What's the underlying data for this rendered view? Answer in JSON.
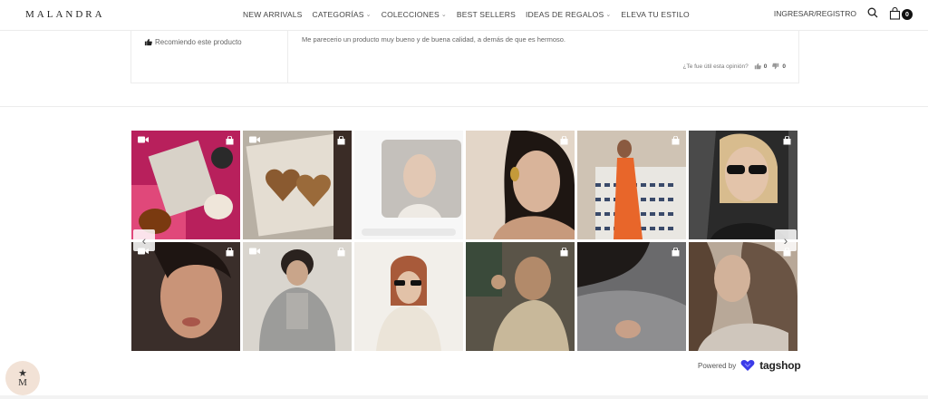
{
  "brand": {
    "logo": "MALANDRA"
  },
  "nav": {
    "items": [
      {
        "label": "NEW ARRIVALS",
        "has_dropdown": false
      },
      {
        "label": "CATEGORÍAS",
        "has_dropdown": true
      },
      {
        "label": "COLECCIONES",
        "has_dropdown": true
      },
      {
        "label": "BEST SELLERS",
        "has_dropdown": false
      },
      {
        "label": "IDEAS DE REGALOS",
        "has_dropdown": true
      },
      {
        "label": "ELEVA TU ESTILO",
        "has_dropdown": false
      }
    ],
    "login_label": "INGRESAR/REGISTRO",
    "cart_count": "0",
    "icons": {
      "search": "search-icon",
      "cart": "bag-icon"
    }
  },
  "review": {
    "recommend_label": "Recomiendo este producto",
    "text": "Me parecerio un producto muy bueno y de buena calidad, a demás de que es hermoso.",
    "helpful_label": "¿Te fue útil esta opinión?",
    "helpful_yes": "0",
    "helpful_no": "0"
  },
  "gallery": {
    "tiles": [
      {
        "name": "gallery-tile-1",
        "video": true,
        "bg": "#b02a5a"
      },
      {
        "name": "gallery-tile-2",
        "video": true,
        "bg": "#c9c3b8"
      },
      {
        "name": "gallery-tile-3",
        "video": false,
        "bg": "#f5f5f5",
        "bag": false
      },
      {
        "name": "gallery-tile-4",
        "video": false,
        "bg": "#d6c5b5"
      },
      {
        "name": "gallery-tile-5",
        "video": false,
        "bg": "#c66a3a"
      },
      {
        "name": "gallery-tile-6",
        "video": false,
        "bg": "#3a3a3a"
      },
      {
        "name": "gallery-tile-7",
        "video": true,
        "bg": "#4a3a34"
      },
      {
        "name": "gallery-tile-8",
        "video": true,
        "bg": "#9a9a98"
      },
      {
        "name": "gallery-tile-9",
        "video": false,
        "bg": "#f0ece8",
        "bag": false
      },
      {
        "name": "gallery-tile-10",
        "video": false,
        "bg": "#6e665a"
      },
      {
        "name": "gallery-tile-11",
        "video": false,
        "bg": "#7a7a7c"
      },
      {
        "name": "gallery-tile-12",
        "video": false,
        "bg": "#9b8d80"
      }
    ],
    "prev_label": "‹",
    "next_label": "›"
  },
  "powered_by": {
    "label": "Powered by",
    "brand": "tagshop"
  },
  "colors": {
    "accent": "#111111",
    "tagshop_logo": "#3b3be8"
  }
}
